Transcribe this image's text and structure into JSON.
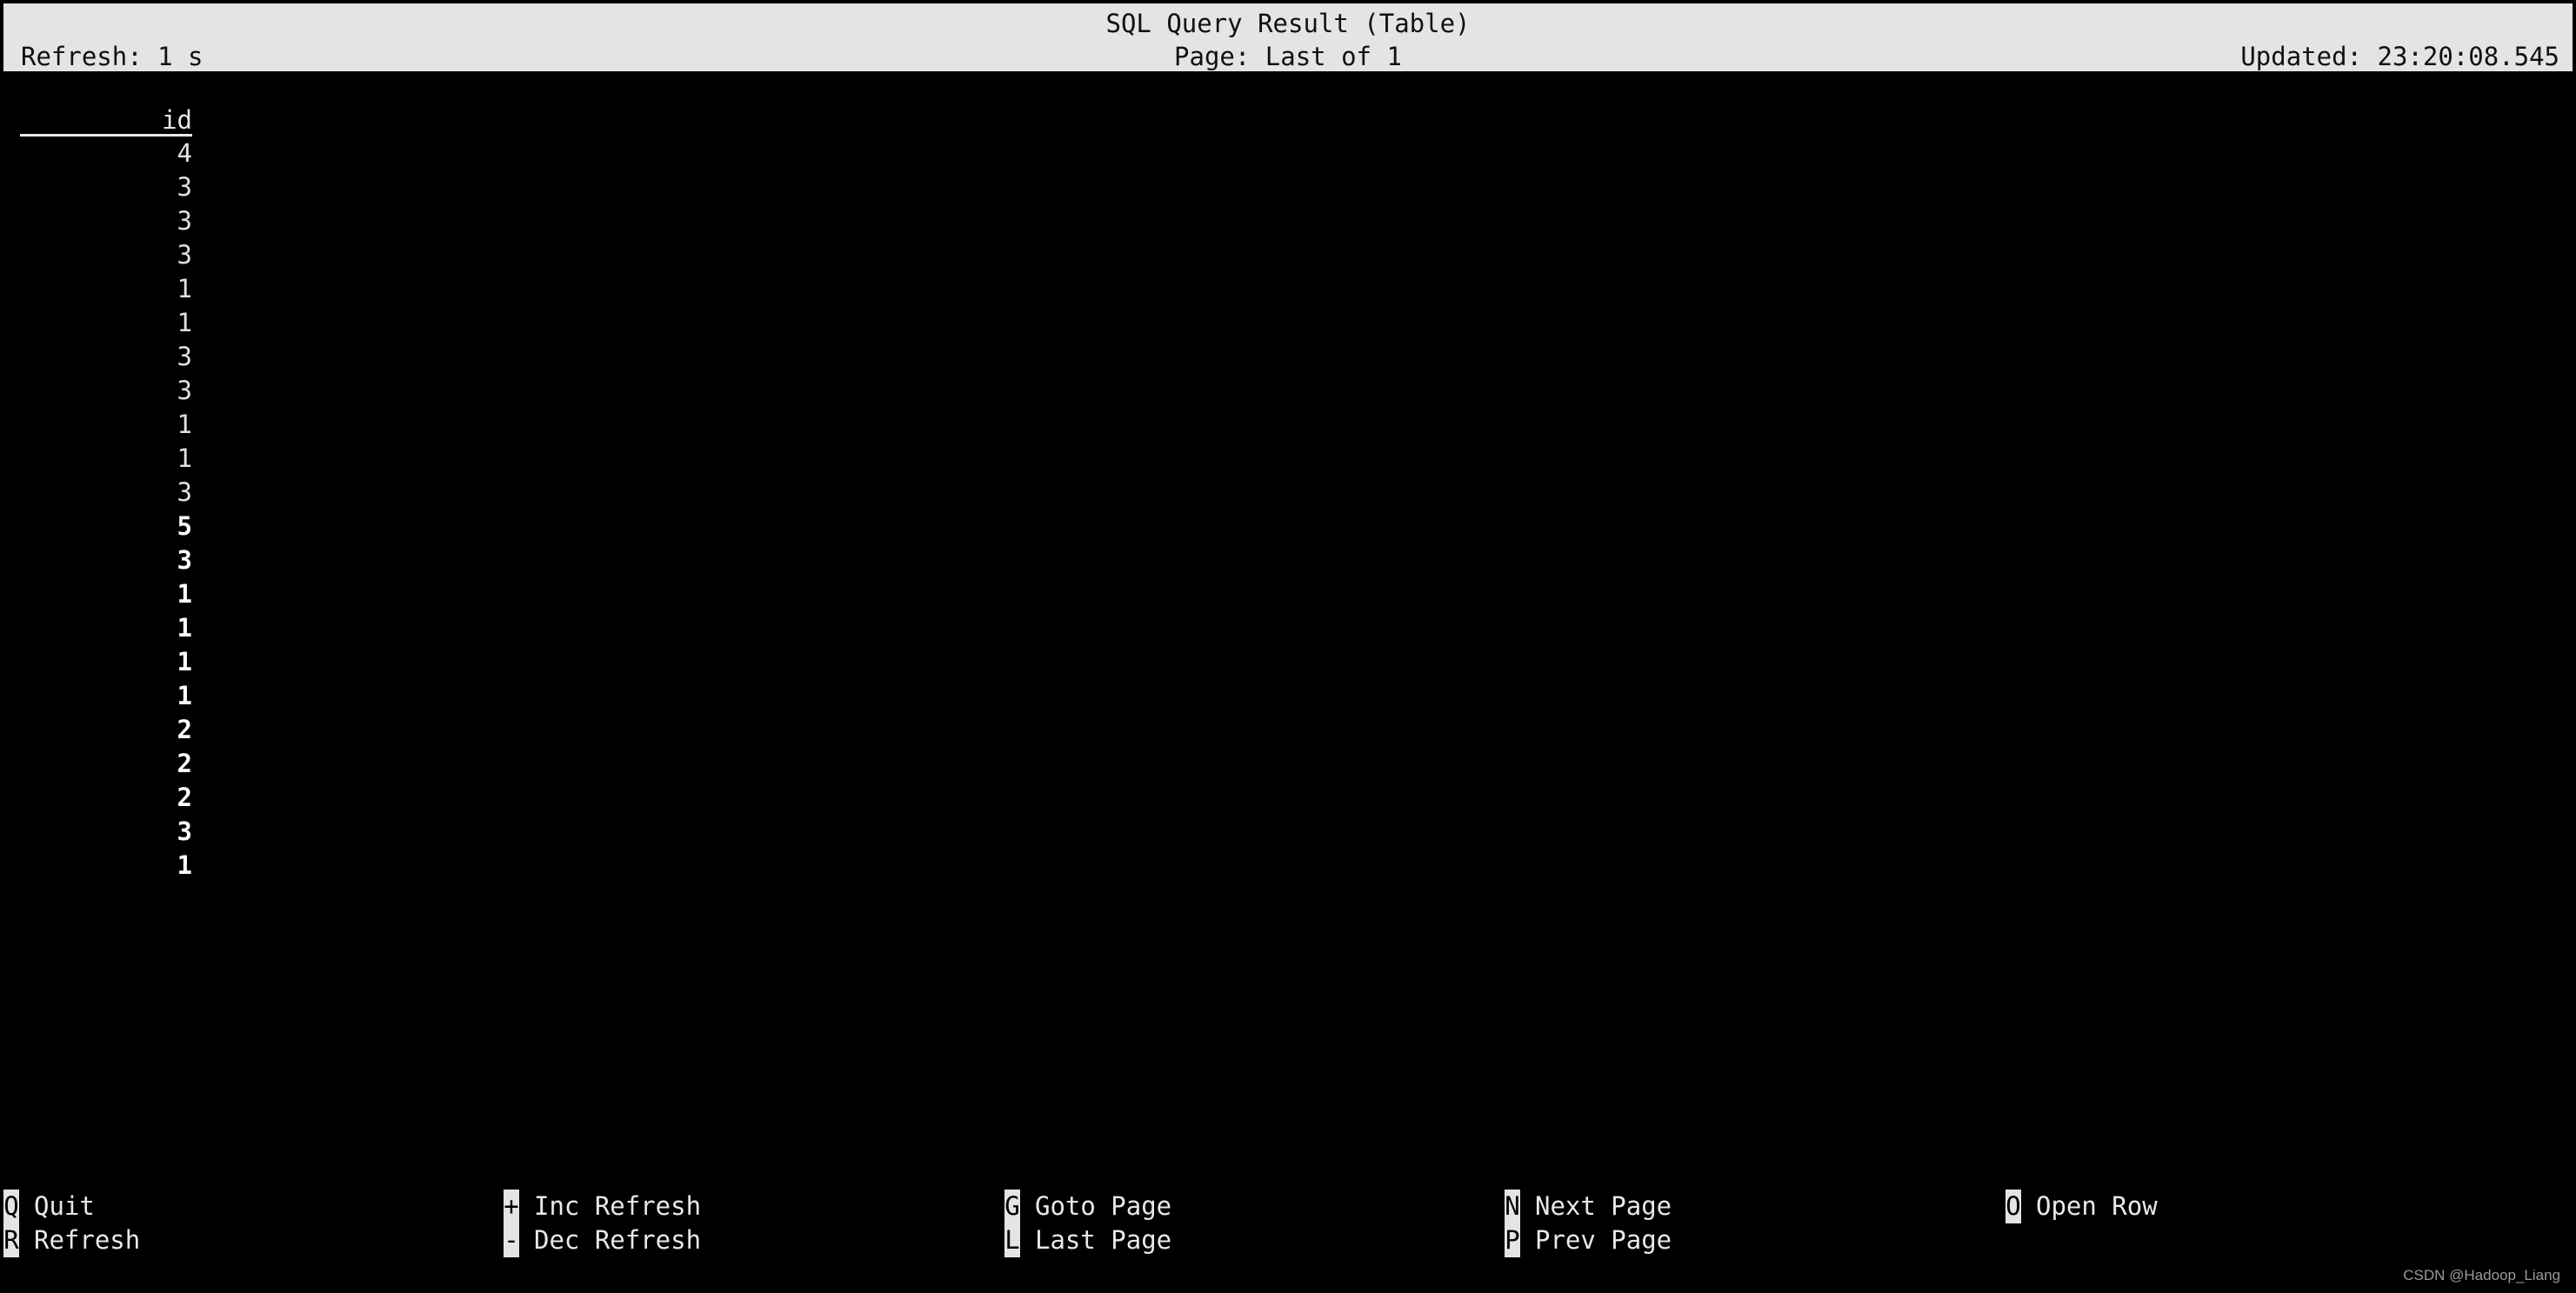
{
  "header": {
    "title": "SQL Query Result (Table)",
    "refresh": "Refresh: 1 s",
    "page": "Page: Last of 1",
    "updated": "Updated: 23:20:08.545"
  },
  "colors": {
    "header_bg": "#e4e4e4",
    "header_text": "#111111",
    "terminal_bg": "#000000",
    "terminal_text": "#e8e8e8"
  },
  "table": {
    "columns": [
      "id"
    ],
    "rows": [
      {
        "id": "4",
        "bold": false
      },
      {
        "id": "3",
        "bold": false
      },
      {
        "id": "3",
        "bold": false
      },
      {
        "id": "3",
        "bold": false
      },
      {
        "id": "1",
        "bold": false
      },
      {
        "id": "1",
        "bold": false
      },
      {
        "id": "3",
        "bold": false
      },
      {
        "id": "3",
        "bold": false
      },
      {
        "id": "1",
        "bold": false
      },
      {
        "id": "1",
        "bold": false
      },
      {
        "id": "3",
        "bold": false
      },
      {
        "id": "5",
        "bold": true
      },
      {
        "id": "3",
        "bold": true
      },
      {
        "id": "1",
        "bold": true
      },
      {
        "id": "1",
        "bold": true
      },
      {
        "id": "1",
        "bold": true
      },
      {
        "id": "1",
        "bold": true
      },
      {
        "id": "2",
        "bold": true
      },
      {
        "id": "2",
        "bold": true
      },
      {
        "id": "2",
        "bold": true
      },
      {
        "id": "3",
        "bold": true
      },
      {
        "id": "1",
        "bold": true
      }
    ]
  },
  "footer": {
    "columns": [
      [
        {
          "key": "Q",
          "label": "Quit"
        },
        {
          "key": "R",
          "label": "Refresh"
        }
      ],
      [
        {
          "key": "+",
          "label": "Inc Refresh"
        },
        {
          "key": "-",
          "label": "Dec Refresh"
        }
      ],
      [
        {
          "key": "G",
          "label": "Goto Page"
        },
        {
          "key": "L",
          "label": "Last Page"
        }
      ],
      [
        {
          "key": "N",
          "label": "Next Page"
        },
        {
          "key": "P",
          "label": "Prev Page"
        }
      ],
      [
        {
          "key": "O",
          "label": "Open Row"
        }
      ]
    ]
  },
  "watermark": "CSDN @Hadoop_Liang"
}
